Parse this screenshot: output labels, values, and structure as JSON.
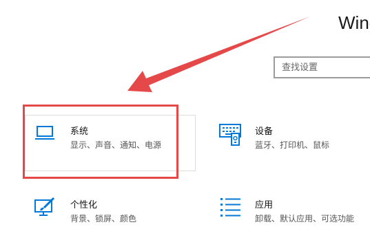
{
  "header": {
    "title": "Wind"
  },
  "search": {
    "placeholder": "查找设置"
  },
  "tiles": [
    {
      "name": "系统",
      "desc": "显示、声音、通知、电源",
      "icon": "laptop-icon"
    },
    {
      "name": "设备",
      "desc": "蓝牙、打印机、鼠标",
      "icon": "keyboard-device-icon"
    },
    {
      "name": "个性化",
      "desc": "背景、锁屏、颜色",
      "icon": "paint-brush-icon"
    },
    {
      "name": "应用",
      "desc": "卸载、默认应用、可选功能",
      "icon": "apps-list-icon"
    }
  ],
  "colors": {
    "accent": "#0078d7",
    "annotation": "#e54848"
  }
}
